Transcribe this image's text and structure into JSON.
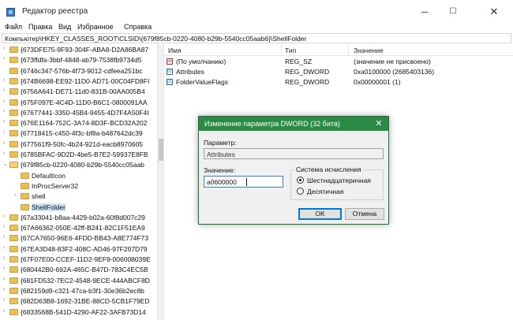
{
  "window": {
    "title": "Редактор реестра",
    "buttons": {
      "minimize": "─",
      "maximize": "☐",
      "close": "✕"
    }
  },
  "menu": [
    "Файл",
    "Правка",
    "Вид",
    "Избранное",
    "Справка"
  ],
  "address": "Компьютер\\HKEY_CLASSES_ROOT\\CLSID\\{679f85cb-0220-4080-b29b-5540cc05aab6}\\ShellFolder",
  "tree": {
    "items": [
      {
        "label": "{673DFE75-9F93-304F-ABA8-D2A86BA87",
        "expander": "›"
      },
      {
        "label": "{673ffdfa-3bbf-4848-ab79-7538fb9734d5",
        "expander": "›"
      },
      {
        "label": "{6746c347-576b-4f73-9012-cdfeea251bc",
        "expander": ""
      },
      {
        "label": "{674B6698-EE92-11D0-AD71-00C04FD8FI",
        "expander": "›"
      },
      {
        "label": "{6756A641-DE71-11d0-831B-00AA005B4",
        "expander": "›"
      },
      {
        "label": "{675F097E-4C4D-11D0-B6C1-0800091AA",
        "expander": "›"
      },
      {
        "label": "{67677441-3350-45B4-9455-4D7F4A50F4I",
        "expander": "›"
      },
      {
        "label": "{676E1164-752C-3A74-8D3F-BCD32A202",
        "expander": "›"
      },
      {
        "label": "{67718415-c450-4f3c-bf8a-b487642dc39",
        "expander": "›"
      },
      {
        "label": "{677561f9-50fc-4b24-921d-eacb8970605",
        "expander": "›"
      },
      {
        "label": "{6785BFAC-9D2D-4be5-B7E2-59937E8FB",
        "expander": "›"
      },
      {
        "label": "{679f85cb-0220-4080-b29b-5540cc05aab",
        "expander": "⌄"
      },
      {
        "label": "DefaultIcon",
        "expander": ""
      },
      {
        "label": "InProcServer32",
        "expander": ""
      },
      {
        "label": "shell",
        "expander": "›"
      },
      {
        "label": "ShellFolder",
        "expander": ""
      },
      {
        "label": "{67a33041-b8aa-4429-b02a-60f8d007c29",
        "expander": "›"
      },
      {
        "label": "{67A66362-050E-42ff-B241-82C1F51EA9",
        "expander": "›"
      },
      {
        "label": "{67CA7650-96E6-4FDD-BB43-A8E774F73",
        "expander": "›"
      },
      {
        "label": "{67EA3D48-83F2-408C-AD46-97F207D79",
        "expander": "›"
      },
      {
        "label": "{67F07E00-CCEF-11D2-9EF9-006008039E",
        "expander": "›"
      },
      {
        "label": "{680442B0-692A-465C-B47D-783C4EC5B",
        "expander": "›"
      },
      {
        "label": "{681FD532-7EC2-4548-9ECE-444ABCF8D",
        "expander": "›"
      },
      {
        "label": "{682159d9-c321-47ca-b3f1-30e36b2ec8b",
        "expander": "›"
      },
      {
        "label": "{682D63B8-1692-31BE-88CD-5CB1F79ED",
        "expander": "›"
      },
      {
        "label": "{6833568B-541D-4290-AF22-3AFB73D14",
        "expander": "›"
      }
    ]
  },
  "list": {
    "headers": {
      "name": "Имя",
      "type": "Тип",
      "data": "Значение"
    },
    "rows": [
      {
        "icon": "ab",
        "name": "(По умолчанию)",
        "type": "REG_SZ",
        "data": "(значение не присвоено)"
      },
      {
        "icon": "011",
        "name": "Attributes",
        "type": "REG_DWORD",
        "data": "0xa0100000 (2685403136)"
      },
      {
        "icon": "011",
        "name": "FolderValueFlags",
        "type": "REG_DWORD",
        "data": "0x00000001 (1)"
      }
    ]
  },
  "dialog": {
    "title": "Изменение параметра DWORD (32 бита)",
    "close": "✕",
    "param_label": "Параметр:",
    "param_value": "Attributes",
    "value_label": "Значение:",
    "value_input": "a0600000",
    "group_title": "Система исчисления",
    "radio_hex": "Шестнадцатеричная",
    "radio_dec": "Десятичная",
    "radio_selected": "hex",
    "ok": "OK",
    "cancel": "Отмена"
  },
  "colors": {
    "dialog_title_bar": "#2b8a45",
    "selection": "#cce4f7",
    "folder": "#e6c15b"
  }
}
